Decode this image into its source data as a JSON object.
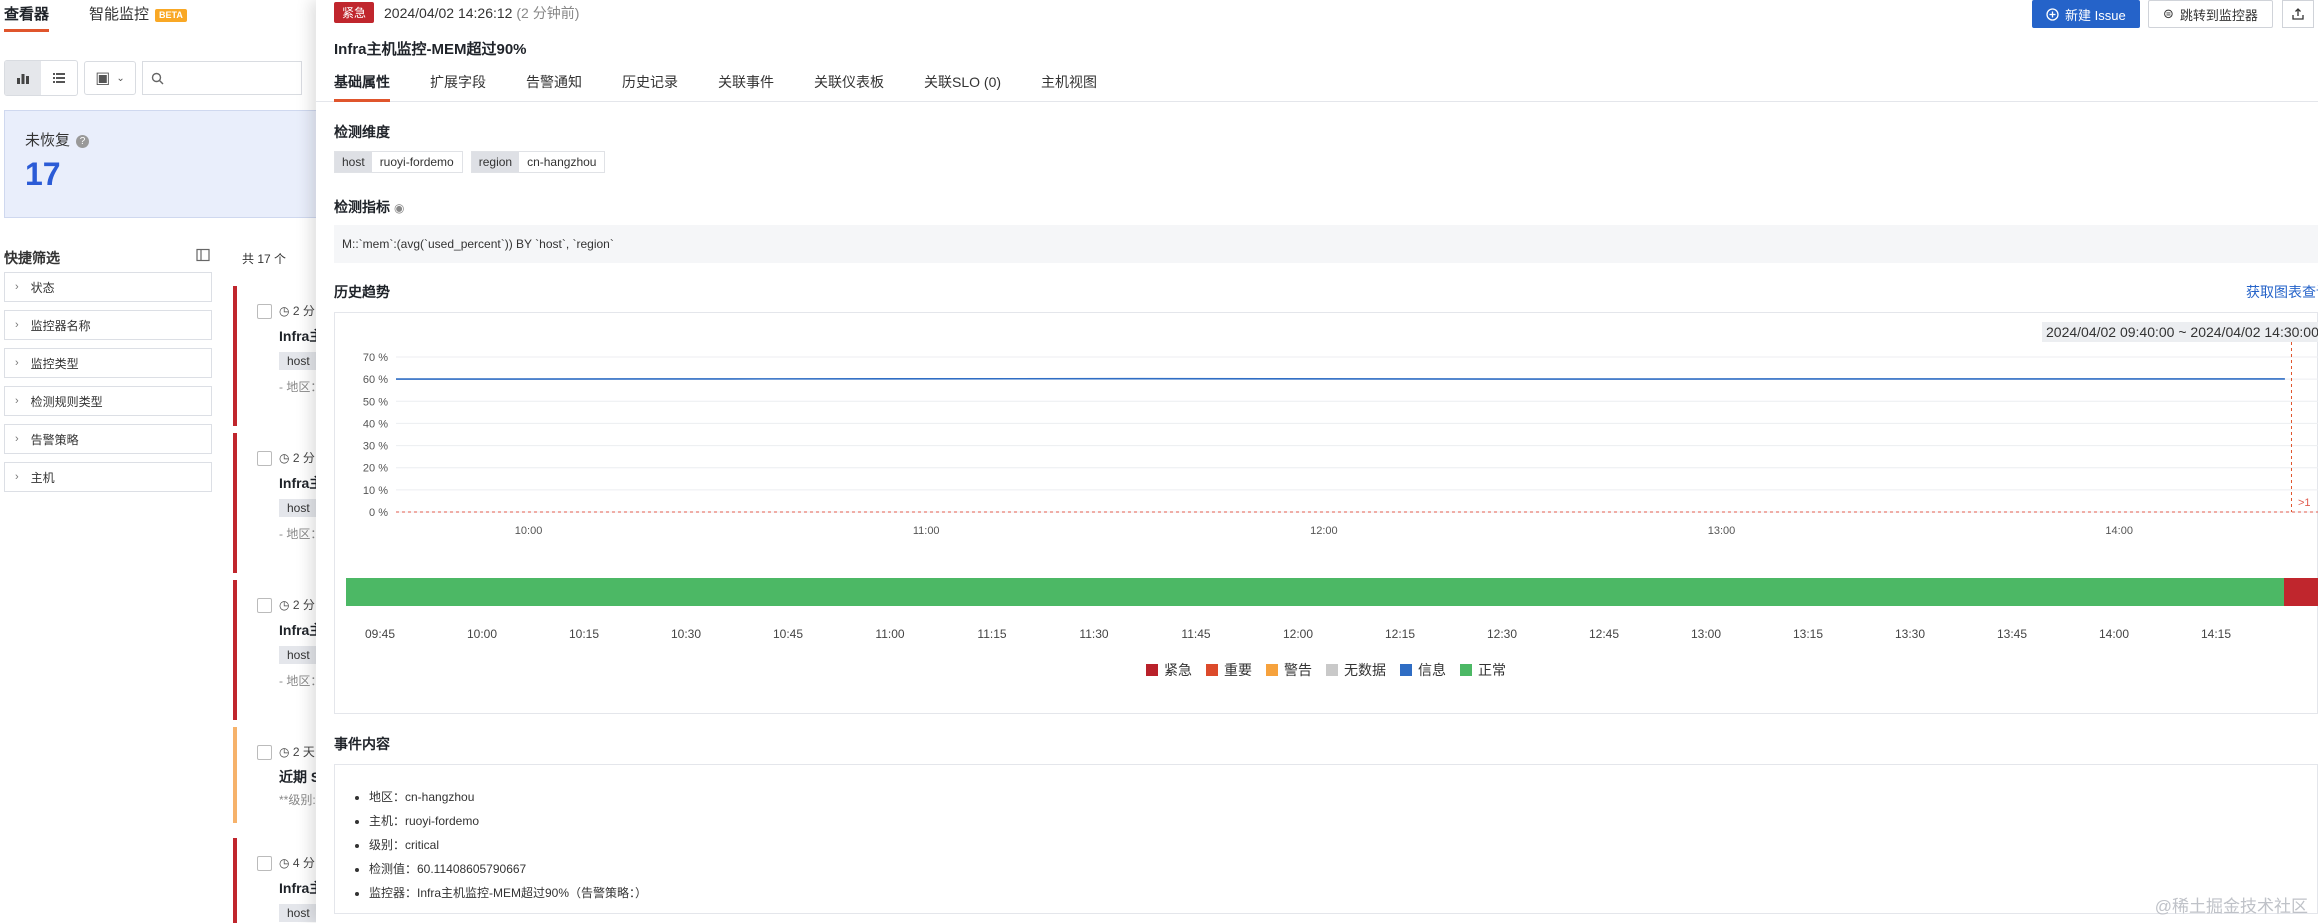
{
  "left": {
    "tabs": [
      {
        "label": "查看器",
        "active": true
      },
      {
        "label": "智能监控",
        "badge": "BETA"
      }
    ],
    "unrecovered": {
      "label": "未恢复",
      "count": "17"
    },
    "quick_filter": {
      "title": "快捷筛选",
      "items": [
        "状态",
        "监控器名称",
        "监控类型",
        "检测规则类型",
        "告警策略",
        "主机"
      ]
    },
    "list_count": "共 17 个",
    "cards": [
      {
        "time": "2 分",
        "title": "Infra主",
        "tag": "host",
        "sub": "- 地区：",
        "level": "critical"
      },
      {
        "time": "2 分",
        "title": "Infra主",
        "tag": "host",
        "sub": "- 地区：",
        "level": "critical"
      },
      {
        "time": "2 分",
        "title": "Infra主",
        "tag": "host",
        "sub": "- 地区：",
        "level": "critical"
      },
      {
        "time": "2 天",
        "title": "近期 S",
        "tag": "",
        "sub": "**级别:",
        "level": "warning"
      },
      {
        "time": "4 分",
        "title": "Infra主",
        "tag": "host",
        "sub": "",
        "level": "critical"
      }
    ]
  },
  "drawer": {
    "severity": "紧急",
    "time": "2024/04/02 14:26:12",
    "relative": "(2 分钟前)",
    "title": "Infra主机监控-MEM超过90%",
    "new_issue": "新建 Issue",
    "goto_monitor": "跳转到监控器",
    "tabs": [
      "基础属性",
      "扩展字段",
      "告警通知",
      "历史记录",
      "关联事件",
      "关联仪表板",
      "关联SLO (0)",
      "主机视图"
    ],
    "dimension_title": "检测维度",
    "dimensions": [
      {
        "key": "host",
        "value": "ruoyi-fordemo"
      },
      {
        "key": "region",
        "value": "cn-hangzhou"
      }
    ],
    "metric_title": "检测指标",
    "query": "M::`mem`:(avg(`used_percent`)) BY `host`, `region`",
    "history_title": "历史趋势",
    "chart_link": "获取图表查询",
    "range": "2024/04/02 09:40:00 ~ 2024/04/02 14:30:00",
    "event_title": "事件内容",
    "event_items": [
      "地区：cn-hangzhou",
      "主机：ruoyi-fordemo",
      "级别：critical",
      "检测值：60.11408605790667",
      "监控器：Infra主机监控-MEM超过90%（告警策略：）"
    ]
  },
  "chart_data": [
    {
      "type": "line",
      "title": "",
      "ylabel": "",
      "ylim": [
        0,
        70
      ],
      "y_ticks": [
        "70 %",
        "60 %",
        "50 %",
        "40 %",
        "30 %",
        "20 %",
        "10 %",
        "0 %"
      ],
      "x_ticks": [
        "10:00",
        "11:00",
        "12:00",
        "13:00",
        "14:00"
      ],
      "x_range": [
        "09:40",
        "14:30"
      ],
      "series": [
        {
          "color": "#2f6dc4",
          "x": [
            "09:40",
            "10:30",
            "11:30",
            "12:30",
            "13:30",
            "14:25"
          ],
          "values": [
            60.0,
            60.1,
            60.2,
            60.0,
            60.1,
            60.1
          ]
        }
      ],
      "threshold": {
        "value": 0,
        "label": ">1",
        "color": "#e05b4e"
      },
      "event_marker": "14:26",
      "grid": true
    },
    {
      "type": "bar",
      "x_ticks": [
        "09:45",
        "10:00",
        "10:15",
        "10:30",
        "10:45",
        "11:00",
        "11:15",
        "11:30",
        "11:45",
        "12:00",
        "12:15",
        "12:30",
        "12:45",
        "13:00",
        "13:15",
        "13:30",
        "13:45",
        "14:00",
        "14:15"
      ],
      "segments": [
        {
          "status": "正常",
          "start": "09:40",
          "end": "14:25",
          "color": "#4cb865"
        },
        {
          "status": "紧急",
          "start": "14:25",
          "end": "14:30",
          "color": "#c0262d"
        }
      ],
      "legend": [
        {
          "name": "紧急",
          "color": "#b9212a"
        },
        {
          "name": "重要",
          "color": "#dc4a2b"
        },
        {
          "name": "警告",
          "color": "#f6a23d"
        },
        {
          "name": "无数据",
          "color": "#c9c9c9"
        },
        {
          "name": "信息",
          "color": "#2f6dc4"
        },
        {
          "name": "正常",
          "color": "#4cb865"
        }
      ]
    }
  ],
  "watermark": "@稀土掘金技术社区"
}
